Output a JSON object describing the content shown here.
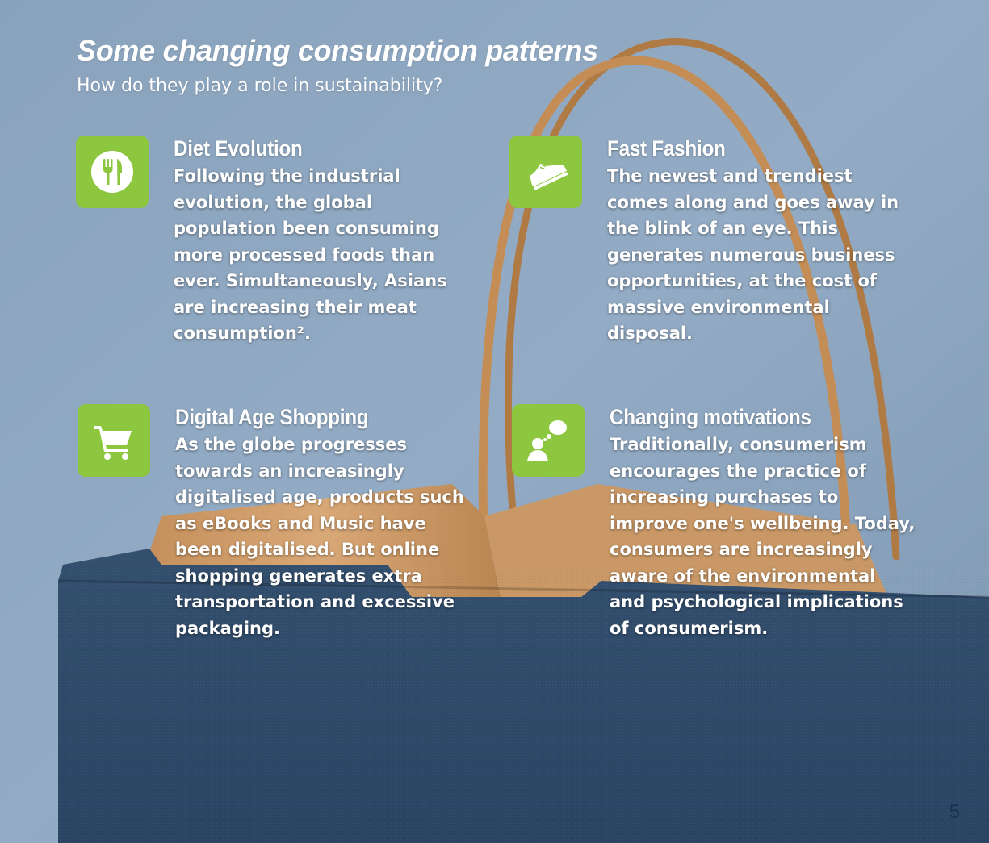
{
  "header": {
    "title": "Some changing consumption patterns",
    "subtitle": "How do they play a role in sustainability?"
  },
  "colors": {
    "accent": "#8dc63f",
    "wall": "#8ea6c0",
    "bag": "#2e4a6b",
    "kraft": "#c99866"
  },
  "cards": [
    {
      "icon": "fork-knife-icon",
      "title": "Diet Evolution",
      "body": "Following the industrial evolution, the global population been consuming more processed foods than ever. Simultaneously, Asians are increasing their meat consumption²."
    },
    {
      "icon": "shoe-icon",
      "title": "Fast Fashion",
      "body": "The newest and trendiest comes along and goes away in the blink of an eye. This generates numerous business opportunities, at the cost of massive environmental disposal."
    },
    {
      "icon": "shopping-cart-icon",
      "title": "Digital Age Shopping",
      "body": "As the globe progresses towards an increasingly digitalised age, products such as eBooks and Music have been digitalised. But online shopping generates extra transportation and excessive packaging."
    },
    {
      "icon": "thinking-person-icon",
      "title": "Changing motivations",
      "body": "Traditionally, consumerism encourages the practice of increasing purchases to improve one's wellbeing. Today, consumers are increasingly aware of the environmental and psychological implications of consumerism."
    }
  ],
  "page_number": "5"
}
